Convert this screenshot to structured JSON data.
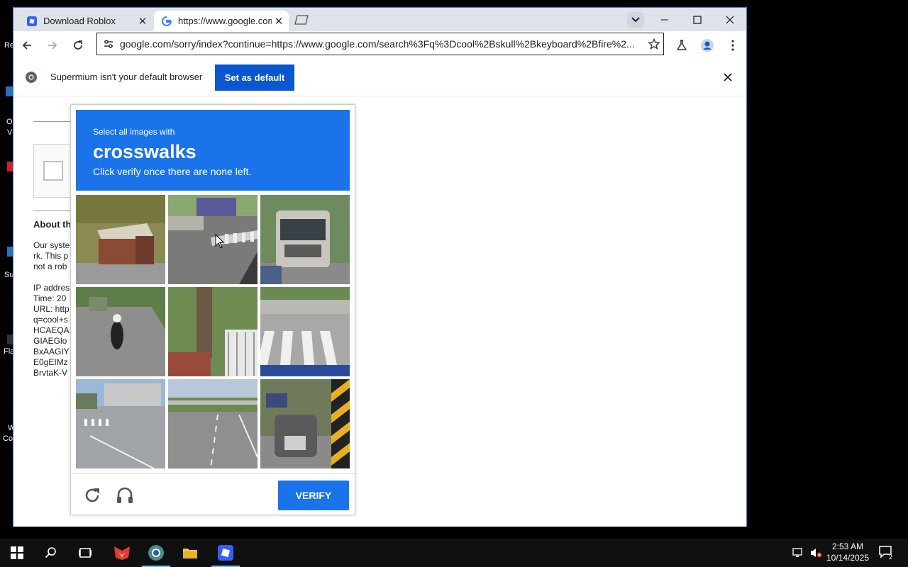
{
  "desktop": {
    "fragments": [
      "Re",
      "O",
      "V",
      "Su",
      "Fla",
      "W",
      "Co"
    ]
  },
  "browser": {
    "tabs": [
      {
        "title": "Download Roblox",
        "icon": "roblox-icon",
        "active": false
      },
      {
        "title": "https://www.google.com",
        "icon": "google-icon",
        "active": true
      }
    ],
    "omnibox": {
      "url": "google.com/sorry/index?continue=https://www.google.com/search%3Fq%3Dcool%2Bskull%2Bkeyboard%2Bfire%2..."
    },
    "infobar": {
      "message": "Supermium isn't your default browser",
      "button": "Set as default"
    }
  },
  "page": {
    "about_heading": "About th",
    "lines": [
      "Our syste",
      "rk. This p",
      "not a rob",
      "",
      "IP addres",
      "Time: 20",
      "URL: http",
      "q=cool+s",
      "HCAEQA",
      "GIAEGlo",
      "BxAAGIY",
      "E0gEIMz",
      "BrvtaK-V"
    ]
  },
  "captcha": {
    "instruction": "Select all images with",
    "target": "crosswalks",
    "hint": "Click verify once there are none left.",
    "verify_label": "VERIFY",
    "tiles": [
      {
        "name": "tile-brick-steps"
      },
      {
        "name": "tile-street-crosswalk"
      },
      {
        "name": "tile-bus"
      },
      {
        "name": "tile-motorcycle-road"
      },
      {
        "name": "tile-tree-gate"
      },
      {
        "name": "tile-crosswalk-closeup"
      },
      {
        "name": "tile-intersection"
      },
      {
        "name": "tile-highway"
      },
      {
        "name": "tile-motorcycle-closeup"
      }
    ]
  },
  "taskbar": {
    "time": "2:53 AM",
    "date": "10/14/2025",
    "notifications": "2"
  },
  "colors": {
    "accent": "#1a73e8",
    "infobar_button": "#0b57d0",
    "tabstrip": "#dee3ea"
  }
}
